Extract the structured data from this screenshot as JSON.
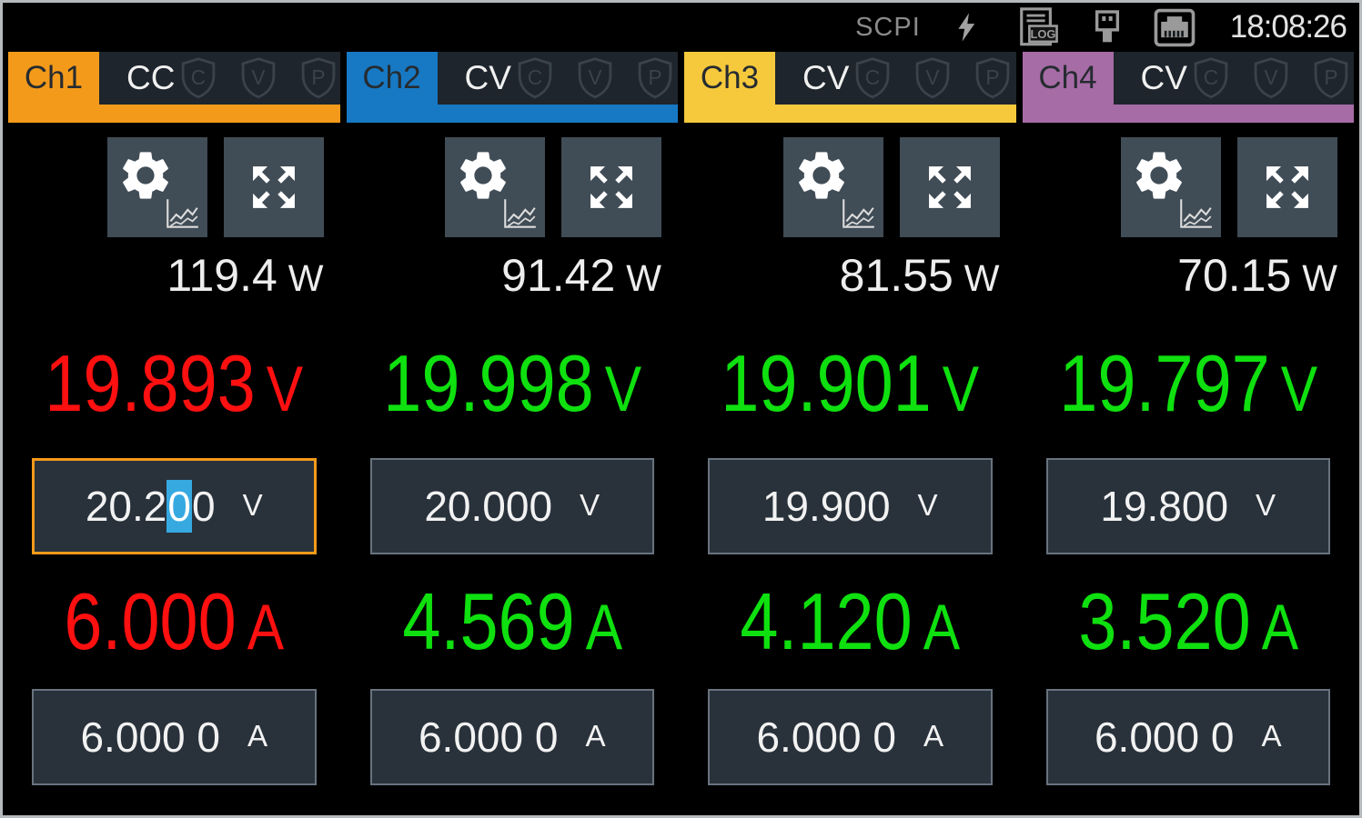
{
  "status_bar": {
    "scpi_label": "SCPI",
    "log_label": "LOG",
    "time": "18:08:26"
  },
  "shields": [
    "C",
    "V",
    "P"
  ],
  "highlight_color": "#36A9E1",
  "channels": [
    {
      "id": "Ch1",
      "mode": "CC",
      "color": "#F49A1A",
      "value_color": "#FF1010",
      "power": "119.4",
      "power_unit": "W",
      "voltage": "19.893",
      "voltage_unit": "V",
      "vset_pre": "20.2",
      "vset_sel": "0",
      "vset_post": "0",
      "vset_unit": "V",
      "vset_selected": true,
      "current": "6.000",
      "current_unit": "A",
      "iset": "6.000 0",
      "iset_unit": "A"
    },
    {
      "id": "Ch2",
      "mode": "CV",
      "color": "#1779C4",
      "value_color": "#0FE00F",
      "power": "91.42",
      "power_unit": "W",
      "voltage": "19.998",
      "voltage_unit": "V",
      "vset_pre": "20.000",
      "vset_sel": "",
      "vset_post": "",
      "vset_unit": "V",
      "vset_selected": false,
      "current": "4.569",
      "current_unit": "A",
      "iset": "6.000 0",
      "iset_unit": "A"
    },
    {
      "id": "Ch3",
      "mode": "CV",
      "color": "#F6C93C",
      "value_color": "#0FE00F",
      "power": "81.55",
      "power_unit": "W",
      "voltage": "19.901",
      "voltage_unit": "V",
      "vset_pre": "19.900",
      "vset_sel": "",
      "vset_post": "",
      "vset_unit": "V",
      "vset_selected": false,
      "current": "4.120",
      "current_unit": "A",
      "iset": "6.000 0",
      "iset_unit": "A"
    },
    {
      "id": "Ch4",
      "mode": "CV",
      "color": "#A66CA6",
      "value_color": "#0FE00F",
      "power": "70.15",
      "power_unit": "W",
      "voltage": "19.797",
      "voltage_unit": "V",
      "vset_pre": "19.800",
      "vset_sel": "",
      "vset_post": "",
      "vset_unit": "V",
      "vset_selected": false,
      "current": "3.520",
      "current_unit": "A",
      "iset": "6.000 0",
      "iset_unit": "A"
    }
  ]
}
